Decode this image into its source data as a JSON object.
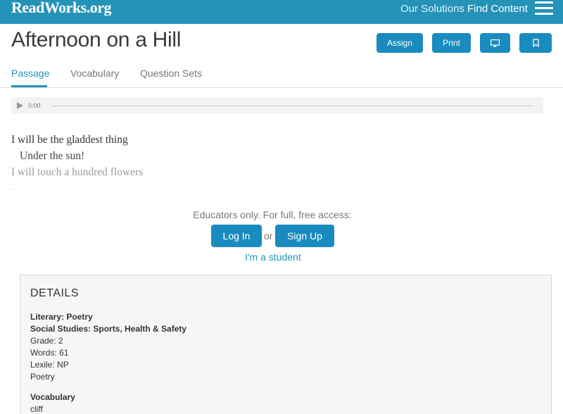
{
  "nav": {
    "logo": "ReadWorks.org",
    "links": [
      "Our Solutions",
      "Find Content"
    ],
    "menu_icon": "hamburger-icon"
  },
  "header": {
    "title": "Afternoon on a Hill",
    "buttons": {
      "assign": "Assign",
      "print": "Print"
    },
    "icons": [
      "presentation-icon",
      "bookmark-icon"
    ]
  },
  "tabs": [
    "Passage",
    "Vocabulary",
    "Question Sets"
  ],
  "active_tab": "Passage",
  "audio": {
    "time": "0:00"
  },
  "passage": {
    "lines": [
      "I will be the gladdest thing",
      "Under the sun!",
      "I will touch a hundred flowers",
      "..."
    ]
  },
  "access": {
    "text": "Educators only. For full, free access:",
    "login": "Log In",
    "or": "or",
    "signup": "Sign Up",
    "student": "I'm a student"
  },
  "details": {
    "title": "DETAILS",
    "subjects": [
      "Literary: Poetry",
      "Social Studies: Sports, Health & Safety"
    ],
    "grade": "Grade: 2",
    "words": "Words: 61",
    "lexile": "Lexile: NP",
    "genre": "Poetry",
    "vocab_label": "Vocabulary",
    "vocab_first": "cliff"
  },
  "colors": {
    "brand": "#2593b8",
    "button": "#1a8bbf"
  }
}
